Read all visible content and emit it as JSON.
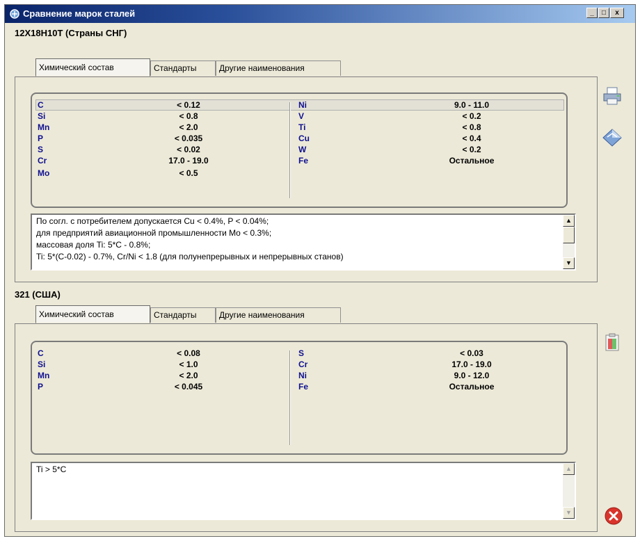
{
  "window": {
    "title": "Сравнение марок сталей",
    "controls": [
      "_",
      "□",
      "x"
    ]
  },
  "section1": {
    "title": "12Х18Н10Т (Страны СНГ)",
    "tabs": [
      "Химический состав",
      "Стандарты",
      "Другие наименования"
    ],
    "left": [
      {
        "el": "C",
        "val": "< 0.12"
      },
      {
        "el": "Si",
        "val": "< 0.8"
      },
      {
        "el": "Mn",
        "val": "< 2.0"
      },
      {
        "el": "P",
        "val": "< 0.035"
      },
      {
        "el": "S",
        "val": "< 0.02"
      },
      {
        "el": "Cr",
        "val": "17.0 - 19.0"
      },
      {
        "el": "Mo",
        "val": "< 0.5"
      }
    ],
    "right": [
      {
        "el": "Ni",
        "val": "9.0 - 11.0"
      },
      {
        "el": "V",
        "val": "< 0.2"
      },
      {
        "el": "Ti",
        "val": "< 0.8"
      },
      {
        "el": "Cu",
        "val": "< 0.4"
      },
      {
        "el": "W",
        "val": "< 0.2"
      },
      {
        "el": "Fe",
        "val": "Остальное"
      }
    ],
    "notes": [
      "По согл. с потребителем допускается Cu < 0.4%, P < 0.04%;",
      "для предприятий авиационной промышленности Mo < 0.3%;",
      "массовая доля Ti: 5*C - 0.8%;",
      "Ti: 5*(C-0.02) - 0.7%, Cr/Ni < 1.8 (для полунепрерывных и непрерывных станов)"
    ]
  },
  "section2": {
    "title": "321 (США)",
    "tabs": [
      "Химический состав",
      "Стандарты",
      "Другие наименования"
    ],
    "left": [
      {
        "el": "C",
        "val": "< 0.08"
      },
      {
        "el": "Si",
        "val": "< 1.0"
      },
      {
        "el": "Mn",
        "val": "< 2.0"
      },
      {
        "el": "P",
        "val": "< 0.045"
      }
    ],
    "right": [
      {
        "el": "S",
        "val": "< 0.03"
      },
      {
        "el": "Cr",
        "val": "17.0 - 19.0"
      },
      {
        "el": "Ni",
        "val": "9.0 - 12.0"
      },
      {
        "el": "Fe",
        "val": "Остальное"
      }
    ],
    "notes": [
      "Ti > 5*C"
    ]
  },
  "icons": {
    "print": "printer-icon",
    "export": "diamond-icon",
    "copy": "clipboard-icon",
    "close": "close-icon"
  }
}
